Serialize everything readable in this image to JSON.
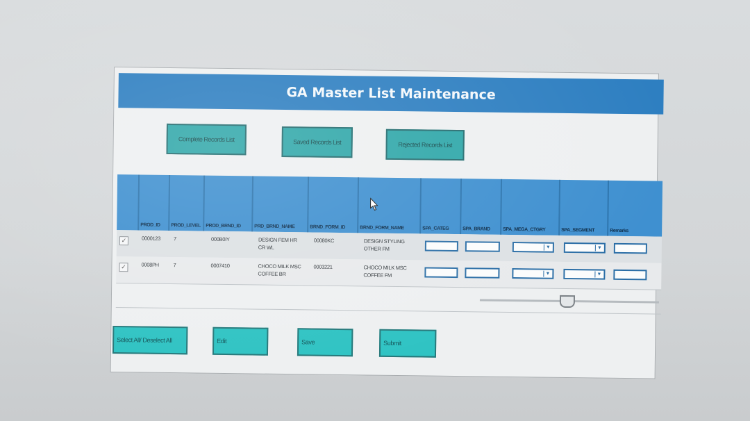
{
  "window": {
    "title": "GA Master List Maintenance"
  },
  "top_buttons": [
    {
      "label": "Complete Records List"
    },
    {
      "label": "Saved Records List"
    },
    {
      "label": "Rejected Records List"
    }
  ],
  "grid": {
    "columns": [
      {
        "label": ""
      },
      {
        "label": "PROD_ID"
      },
      {
        "label": "PROD_LEVEL"
      },
      {
        "label": "PROD_BRND_ID"
      },
      {
        "label": "PRD_BRND_NAME"
      },
      {
        "label": "BRND_FORM_ID"
      },
      {
        "label": "BRND_FORM_NAME"
      },
      {
        "label": "SPA_CATEG"
      },
      {
        "label": "SPA_BRAND"
      },
      {
        "label": "SPA_MEGA_CTGRY"
      },
      {
        "label": "SPA_SEGMENT"
      },
      {
        "label": "Remarks"
      }
    ],
    "rows": [
      {
        "checked": "✓",
        "prod_id": "0000123",
        "prod_level": "7",
        "prod_brnd_id": "000B0IY",
        "prd_brnd_name": "DESIGN FEM HR CR WL",
        "brnd_form_id": "00080KC",
        "brnd_form_name": "DESIGN STYLING OTHER FM"
      },
      {
        "checked": "✓",
        "prod_id": "0008PH",
        "prod_level": "7",
        "prod_brnd_id": "0007410",
        "prd_brnd_name": "CHOCO MILK MSC COFFEE BR",
        "brnd_form_id": "0003221",
        "brnd_form_name": "CHOCO MILK MSC COFFEE FM"
      }
    ]
  },
  "bottom_buttons": [
    {
      "label": "Select All/ Deselect All"
    },
    {
      "label": "Edit"
    },
    {
      "label": "Save"
    },
    {
      "label": "Submit"
    }
  ],
  "icons": {
    "checkbox": "check-icon",
    "dropdown": "chevron-down-icon",
    "cursor": "pointer-cursor-icon"
  },
  "colors": {
    "title_bar": "#2e7fc1",
    "grid_header": "#3f90d0",
    "button": "#2fa7a9",
    "bottom_button": "#2fc3c3"
  }
}
